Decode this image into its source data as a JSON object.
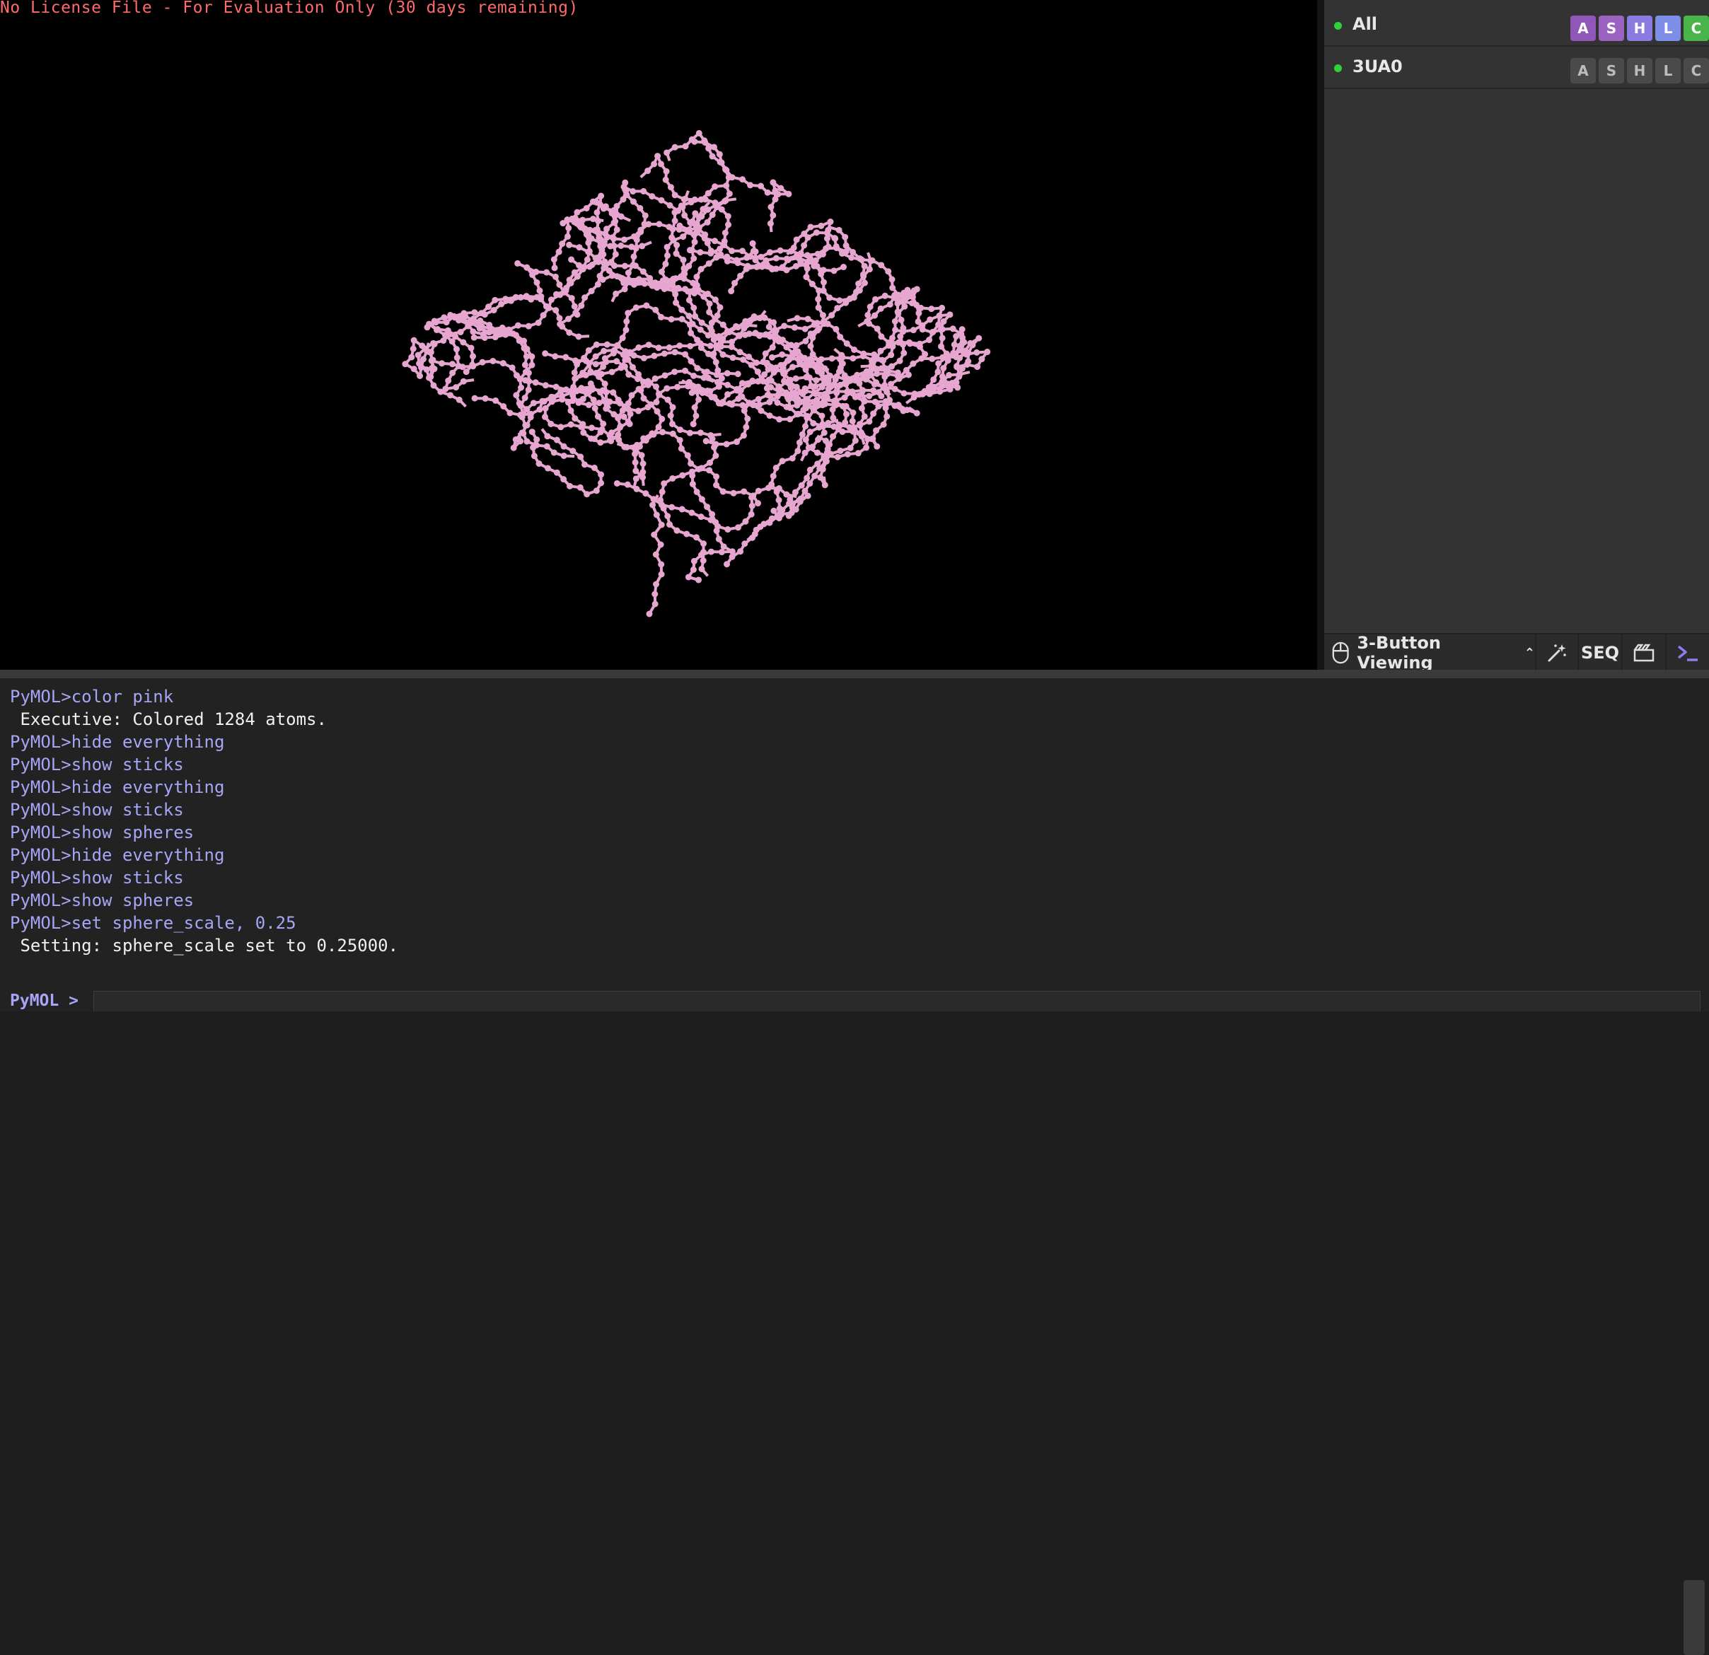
{
  "viewport": {
    "license_text": "No License File - For Evaluation Only (30 days remaining)",
    "background": "#000000",
    "molecule_color": "#e7a6cf"
  },
  "object_panel": {
    "rows": [
      {
        "name": "All",
        "enabled": true,
        "buttons": [
          "A",
          "S",
          "H",
          "L",
          "C"
        ],
        "colored": true
      },
      {
        "name": "3UA0",
        "enabled": true,
        "buttons": [
          "A",
          "S",
          "H",
          "L",
          "C"
        ],
        "colored": false
      }
    ],
    "button_colors": {
      "A": "#8e57b8",
      "S": "#9b62c0",
      "H": "#8a7be0",
      "L": "#7e8ee6",
      "C": "#49b449"
    }
  },
  "toolbar": {
    "mouse_mode_label": "3-Button Viewing",
    "mouse_icon": "mouse-icon",
    "wand_icon": "magic-wand-icon",
    "seq_label": "SEQ",
    "movie_icon": "clapperboard-icon",
    "console_icon": "terminal-icon"
  },
  "console": {
    "lines": [
      {
        "type": "cmd",
        "text": "PyMOL>color pink"
      },
      {
        "type": "out",
        "text": " Executive: Colored 1284 atoms."
      },
      {
        "type": "cmd",
        "text": "PyMOL>hide everything"
      },
      {
        "type": "cmd",
        "text": "PyMOL>show sticks"
      },
      {
        "type": "cmd",
        "text": "PyMOL>hide everything"
      },
      {
        "type": "cmd",
        "text": "PyMOL>show sticks"
      },
      {
        "type": "cmd",
        "text": "PyMOL>show spheres"
      },
      {
        "type": "cmd",
        "text": "PyMOL>hide everything"
      },
      {
        "type": "cmd",
        "text": "PyMOL>show sticks"
      },
      {
        "type": "cmd",
        "text": "PyMOL>show spheres"
      },
      {
        "type": "cmd",
        "text": "PyMOL>set sphere_scale, 0.25"
      },
      {
        "type": "out",
        "text": " Setting: sphere_scale set to 0.25000."
      }
    ],
    "prompt_label": "PyMOL >",
    "input_value": ""
  }
}
